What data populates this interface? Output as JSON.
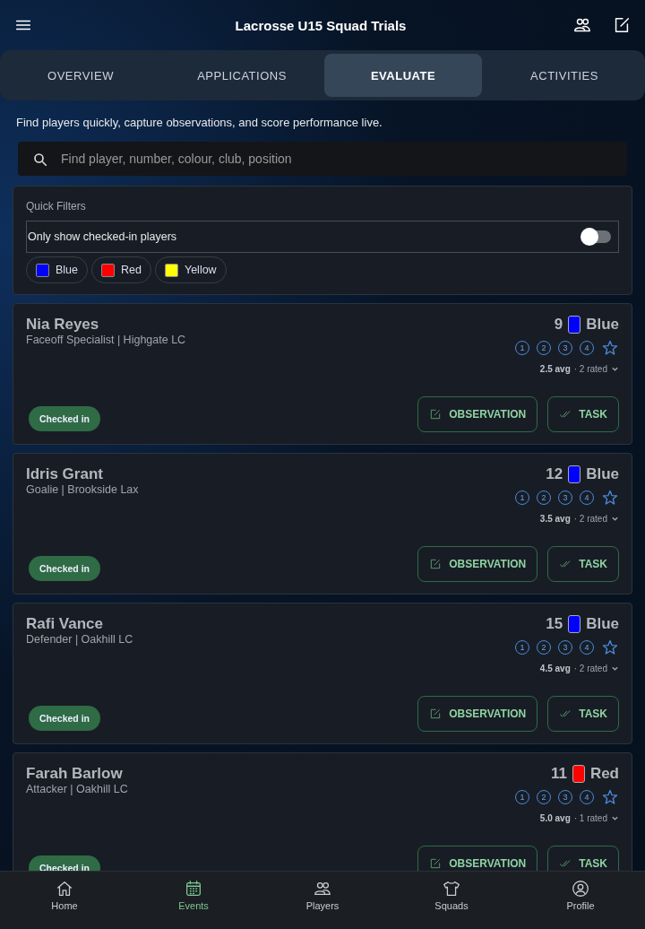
{
  "header": {
    "title": "Lacrosse U15 Squad Trials"
  },
  "tabs": [
    {
      "label": "OVERVIEW",
      "selected": false
    },
    {
      "label": "APPLICATIONS",
      "selected": false
    },
    {
      "label": "EVALUATE",
      "selected": true
    },
    {
      "label": "ACTIVITIES",
      "selected": false
    }
  ],
  "intro": "Find players quickly, capture observations, and score performance live.",
  "search": {
    "placeholder": "Find player, number, colour, club, position"
  },
  "quick_filters": {
    "title": "Quick Filters",
    "toggle": {
      "label": "Only show checked-in players",
      "on": false
    },
    "chips": [
      {
        "label": "Blue",
        "color": "#0000ff"
      },
      {
        "label": "Red",
        "color": "#ff0000"
      },
      {
        "label": "Yellow",
        "color": "#ffff00"
      }
    ]
  },
  "players": [
    {
      "name": "Nia Reyes",
      "role": "Faceoff Specialist | Highgate LC",
      "number": "9",
      "team": "Blue",
      "color": "#0000ff",
      "ratings": [
        "1",
        "2",
        "3",
        "4"
      ],
      "summary": "2.5 avg",
      "rated": "· 2 rated",
      "checked_in": true,
      "status": "Checked in",
      "actions": [
        "OBSERVATION",
        "TASK"
      ]
    },
    {
      "name": "Idris Grant",
      "role": "Goalie | Brookside Lax",
      "number": "12",
      "team": "Blue",
      "color": "#0000ff",
      "ratings": [
        "1",
        "2",
        "3",
        "4"
      ],
      "summary": "3.5 avg",
      "rated": "· 2 rated",
      "checked_in": true,
      "status": "Checked in",
      "actions": [
        "OBSERVATION",
        "TASK"
      ]
    },
    {
      "name": "Rafi Vance",
      "role": "Defender | Oakhill LC",
      "number": "15",
      "team": "Blue",
      "color": "#0000ff",
      "ratings": [
        "1",
        "2",
        "3",
        "4"
      ],
      "summary": "4.5 avg",
      "rated": "· 2 rated",
      "checked_in": true,
      "status": "Checked in",
      "actions": [
        "OBSERVATION",
        "TASK"
      ]
    },
    {
      "name": "Farah Barlow",
      "role": "Attacker | Oakhill LC",
      "number": "11",
      "team": "Red",
      "color": "#ff0000",
      "ratings": [
        "1",
        "2",
        "3",
        "4"
      ],
      "summary": "5.0 avg",
      "rated": "· 1 rated",
      "checked_in": true,
      "status": "Checked in",
      "actions": [
        "OBSERVATION",
        "TASK"
      ]
    }
  ],
  "nav": [
    {
      "label": "Home",
      "selected": false
    },
    {
      "label": "Events",
      "selected": true
    },
    {
      "label": "Players",
      "selected": false
    },
    {
      "label": "Squads",
      "selected": false
    },
    {
      "label": "Profile",
      "selected": false
    }
  ]
}
